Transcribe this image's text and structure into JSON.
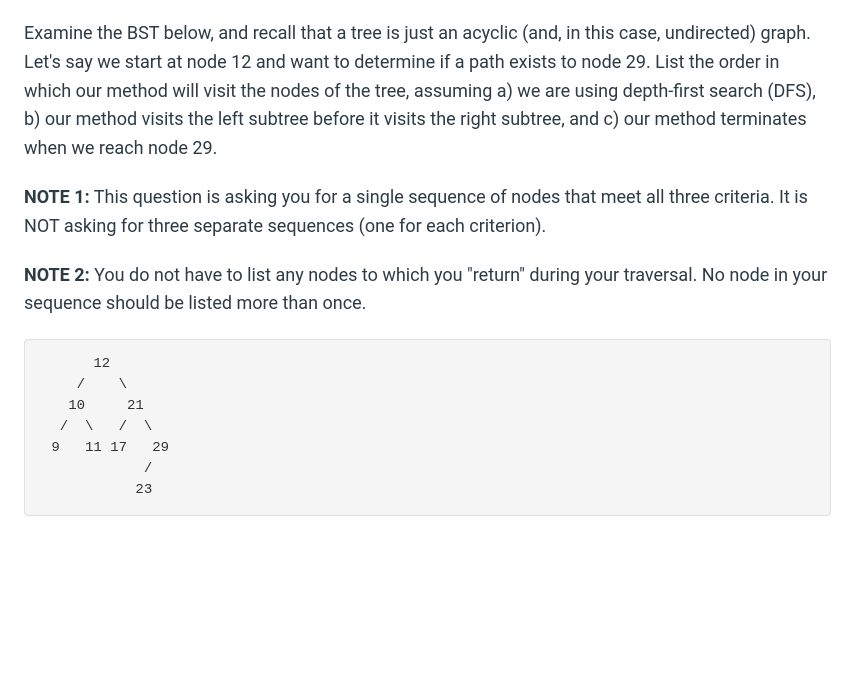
{
  "question": {
    "intro": "Examine the BST below, and recall that a tree is just an acyclic (and, in this case, undirected) graph. Let's say we start at node 12 and want to determine if a path exists to node 29. List the order in which our method will visit the nodes of the tree, assuming a) we are using depth-first search (DFS), b) our method visits the left subtree before it visits the right subtree, and c) our method terminates when we reach node 29."
  },
  "notes": [
    {
      "label": "NOTE 1:",
      "text": " This question is asking you for a single sequence of nodes that meet all three criteria. It is NOT asking for three separate sequences (one for each criterion)."
    },
    {
      "label": "NOTE 2:",
      "text": " You do not have to list any nodes to which you \"return\" during your traversal. No node in your sequence should be listed more than once."
    }
  ],
  "tree_ascii": "      12\n    /    \\\n   10     21\n  /  \\   /  \\\n 9   11 17   29\n            /\n           23"
}
